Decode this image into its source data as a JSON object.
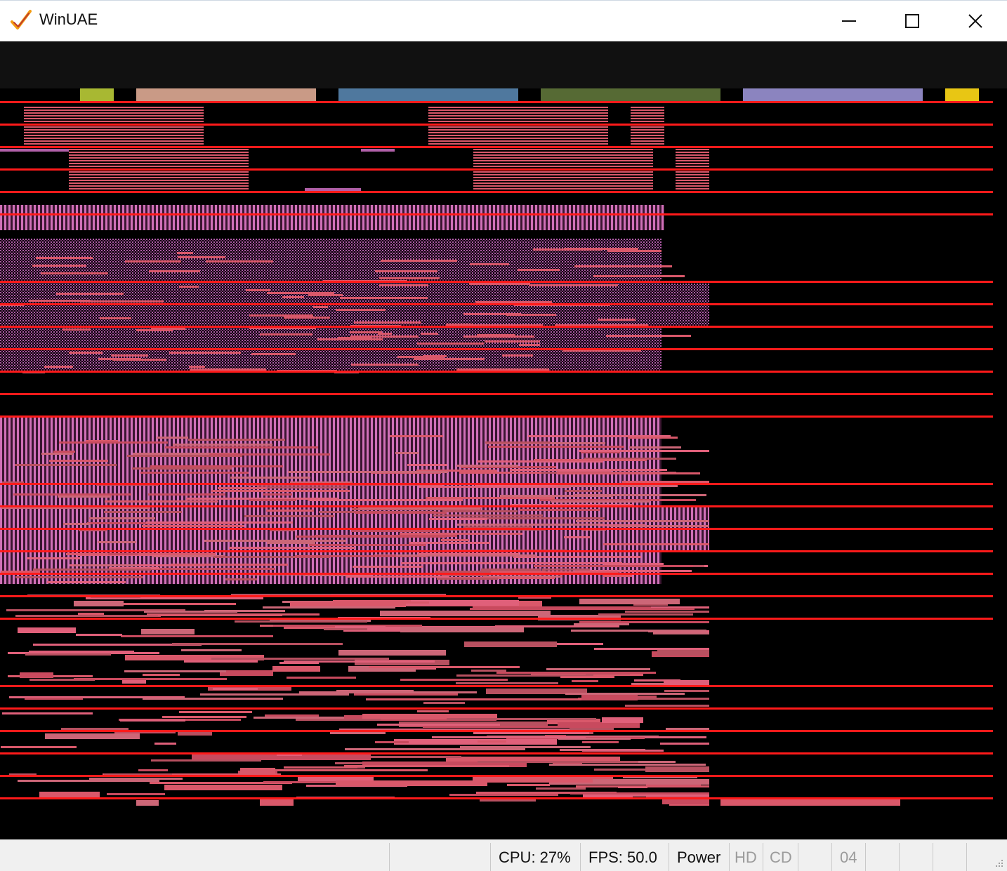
{
  "window": {
    "title": "WinUAE",
    "minimize_icon": "minimize-icon",
    "maximize_icon": "maximize-icon",
    "close_icon": "close-icon"
  },
  "display": {
    "description_colors": {
      "background": "#000000",
      "scanline": "#ff1a1a",
      "pink": "#d9586a",
      "magenta": "#c060b0",
      "salmon": "#cc6677"
    },
    "header_blocks": [
      {
        "color": "#a8b832"
      },
      {
        "color": "#c99a86"
      },
      {
        "color": "#4f789e"
      },
      {
        "color": "#566a34"
      },
      {
        "color": "#8b84bf"
      },
      {
        "color": "#e8c614"
      }
    ]
  },
  "statusbar": {
    "cpu": "CPU: 27%",
    "fps": "FPS: 50.0",
    "power": "Power",
    "hd": "HD",
    "cd": "CD",
    "drive": "04"
  }
}
